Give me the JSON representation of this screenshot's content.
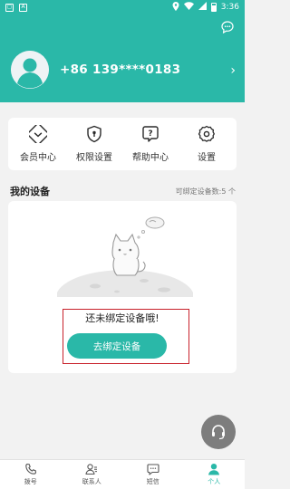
{
  "status_bar": {
    "left_badge": "A",
    "time": "3:36"
  },
  "header": {
    "phone": "+86 139****0183"
  },
  "menu": [
    {
      "label": "会员中心",
      "icon": "vip-diamond-icon"
    },
    {
      "label": "权限设置",
      "icon": "shield-icon"
    },
    {
      "label": "帮助中心",
      "icon": "help-icon"
    },
    {
      "label": "设置",
      "icon": "gear-icon"
    }
  ],
  "devices": {
    "title": "我的设备",
    "bindable_label": "可绑定设备数:5 个",
    "empty_text": "还未绑定设备哦!",
    "bind_button": "去绑定设备"
  },
  "tabbar": [
    {
      "label": "拨号",
      "icon": "phone-icon"
    },
    {
      "label": "联系人",
      "icon": "contacts-icon"
    },
    {
      "label": "短信",
      "icon": "message-icon"
    },
    {
      "label": "个人",
      "icon": "person-icon",
      "active": true
    }
  ],
  "colors": {
    "accent": "#2ab8a8",
    "highlight": "#c8202a",
    "background": "#f2f2f2"
  }
}
